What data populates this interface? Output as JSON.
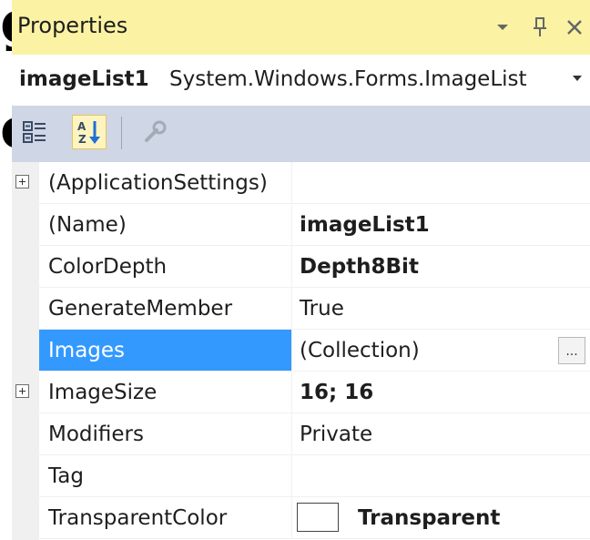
{
  "panel": {
    "title": "Properties",
    "object_name": "imageList1",
    "object_type": "System.Windows.Forms.ImageList"
  },
  "toolbar": {
    "buttons": [
      "categorized-view",
      "alphabetical-view",
      "property-pages"
    ],
    "active": "alphabetical-view"
  },
  "properties": [
    {
      "name": "(ApplicationSettings)",
      "value": "",
      "expandable": true
    },
    {
      "name": "(Name)",
      "value": "imageList1",
      "bold": true
    },
    {
      "name": "ColorDepth",
      "value": "Depth8Bit",
      "bold": true
    },
    {
      "name": "GenerateMember",
      "value": "True"
    },
    {
      "name": "Images",
      "value": "(Collection)",
      "selected": true,
      "button": "..."
    },
    {
      "name": "ImageSize",
      "value": "16; 16",
      "bold": true,
      "expandable": true
    },
    {
      "name": "Modifiers",
      "value": "Private"
    },
    {
      "name": "Tag",
      "value": ""
    },
    {
      "name": "TransparentColor",
      "value": "Transparent",
      "bold": true,
      "swatch": "#ffffff"
    }
  ],
  "colors": {
    "title_bg": "#fbf2a3",
    "toolbar_bg": "#cfd6e5",
    "selection": "#3399ff"
  }
}
